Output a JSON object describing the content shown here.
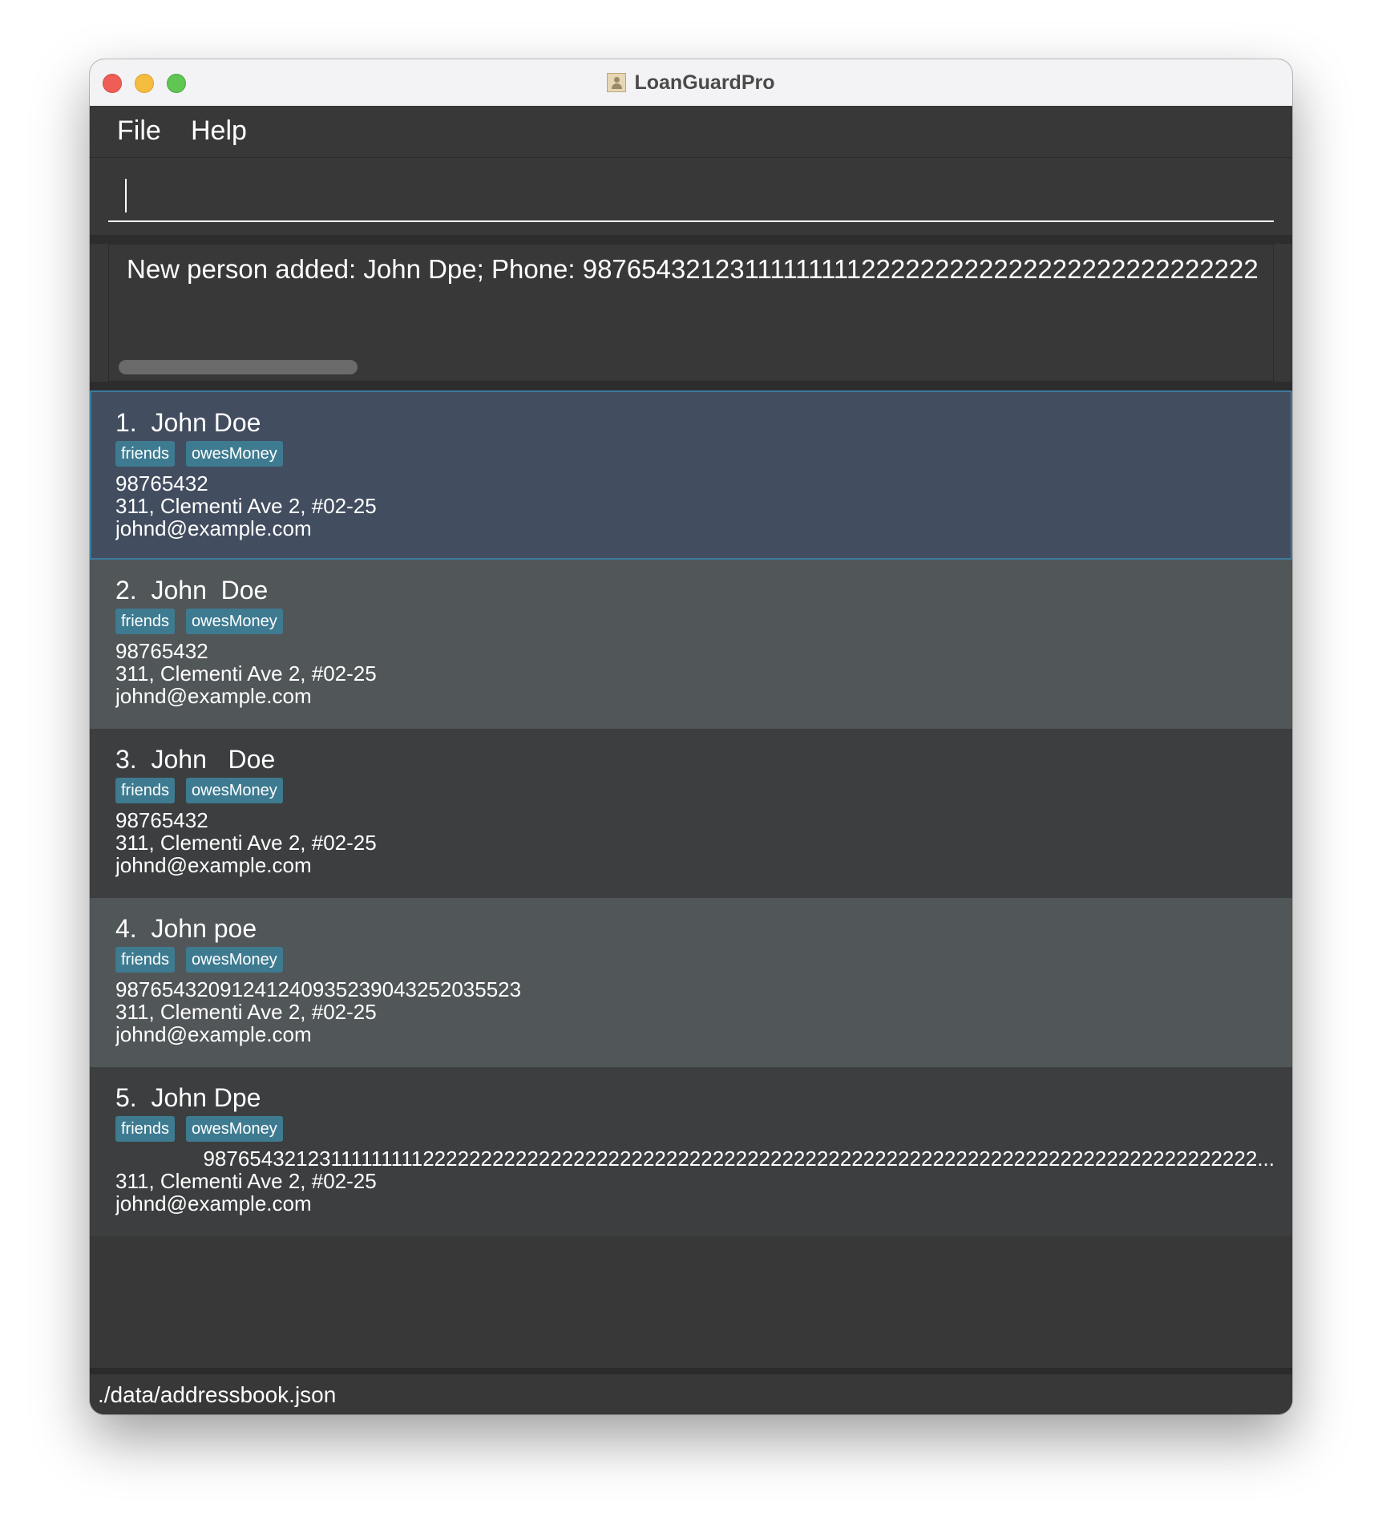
{
  "window": {
    "title": "LoanGuardPro"
  },
  "menu": {
    "file": "File",
    "help": "Help"
  },
  "command_box": {
    "value": ""
  },
  "result_display": {
    "text": "New person added: John Dpe; Phone: 98765432123111111111222222222222222222222222222"
  },
  "persons": [
    {
      "index": "1.",
      "name": "John Doe",
      "tags": [
        "friends",
        "owesMoney"
      ],
      "phone": "98765432",
      "address": "311, Clementi Ave 2, #02-25",
      "email": "johnd@example.com",
      "selected": true
    },
    {
      "index": "2.",
      "name": "John  Doe",
      "tags": [
        "friends",
        "owesMoney"
      ],
      "phone": "98765432",
      "address": "311, Clementi Ave 2, #02-25",
      "email": "johnd@example.com",
      "selected": false
    },
    {
      "index": "3.",
      "name": "John   Doe",
      "tags": [
        "friends",
        "owesMoney"
      ],
      "phone": "98765432",
      "address": "311, Clementi Ave 2, #02-25",
      "email": "johnd@example.com",
      "selected": false
    },
    {
      "index": "4.",
      "name": "John poe",
      "tags": [
        "friends",
        "owesMoney"
      ],
      "phone": "98765432091241240935239043252035523",
      "address": "311, Clementi Ave 2, #02-25",
      "email": "johnd@example.com",
      "selected": false
    },
    {
      "index": "5.",
      "name": "John Dpe",
      "tags": [
        "friends",
        "owesMoney"
      ],
      "phone": "98765432123111111111222222222222222222222222222222222222222222222222222222222222222222222222...",
      "address": "311, Clementi Ave 2, #02-25",
      "email": "johnd@example.com",
      "selected": false
    }
  ],
  "status_bar": {
    "path": "./data/addressbook.json"
  }
}
